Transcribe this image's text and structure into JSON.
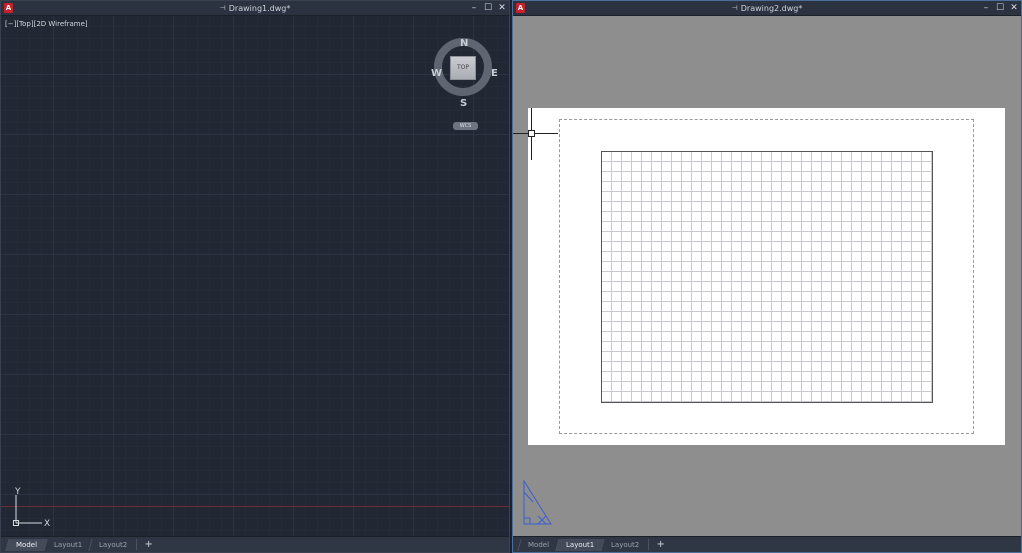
{
  "window1": {
    "title": "Drawing1.dwg*",
    "app_icon": "A",
    "viewport_label": {
      "control": "[−]",
      "view": "[Top]",
      "style": "[2D Wireframe]"
    },
    "viewcube": {
      "face": "TOP",
      "north": "N",
      "south": "S",
      "west": "W",
      "east": "E",
      "wcs": "WCS"
    },
    "ucs": {
      "x": "X",
      "y": "Y"
    },
    "tabs": [
      {
        "label": "Model",
        "active": true
      },
      {
        "label": "Layout1",
        "active": false
      },
      {
        "label": "Layout2",
        "active": false
      }
    ],
    "add_tab": "+"
  },
  "window2": {
    "title": "Drawing2.dwg*",
    "app_icon": "A",
    "tabs": [
      {
        "label": "Model",
        "active": false
      },
      {
        "label": "Layout1",
        "active": true
      },
      {
        "label": "Layout2",
        "active": false
      }
    ],
    "add_tab": "+"
  },
  "window_controls": {
    "minimize": "–",
    "maximize": "☐",
    "close": "✕",
    "pin": "⊣"
  },
  "colors": {
    "model_background": "#212833",
    "paper_background": "#8e8e8e",
    "ucs_paper": "#3a5fd0",
    "active_window_border": "#4a6f9a"
  }
}
